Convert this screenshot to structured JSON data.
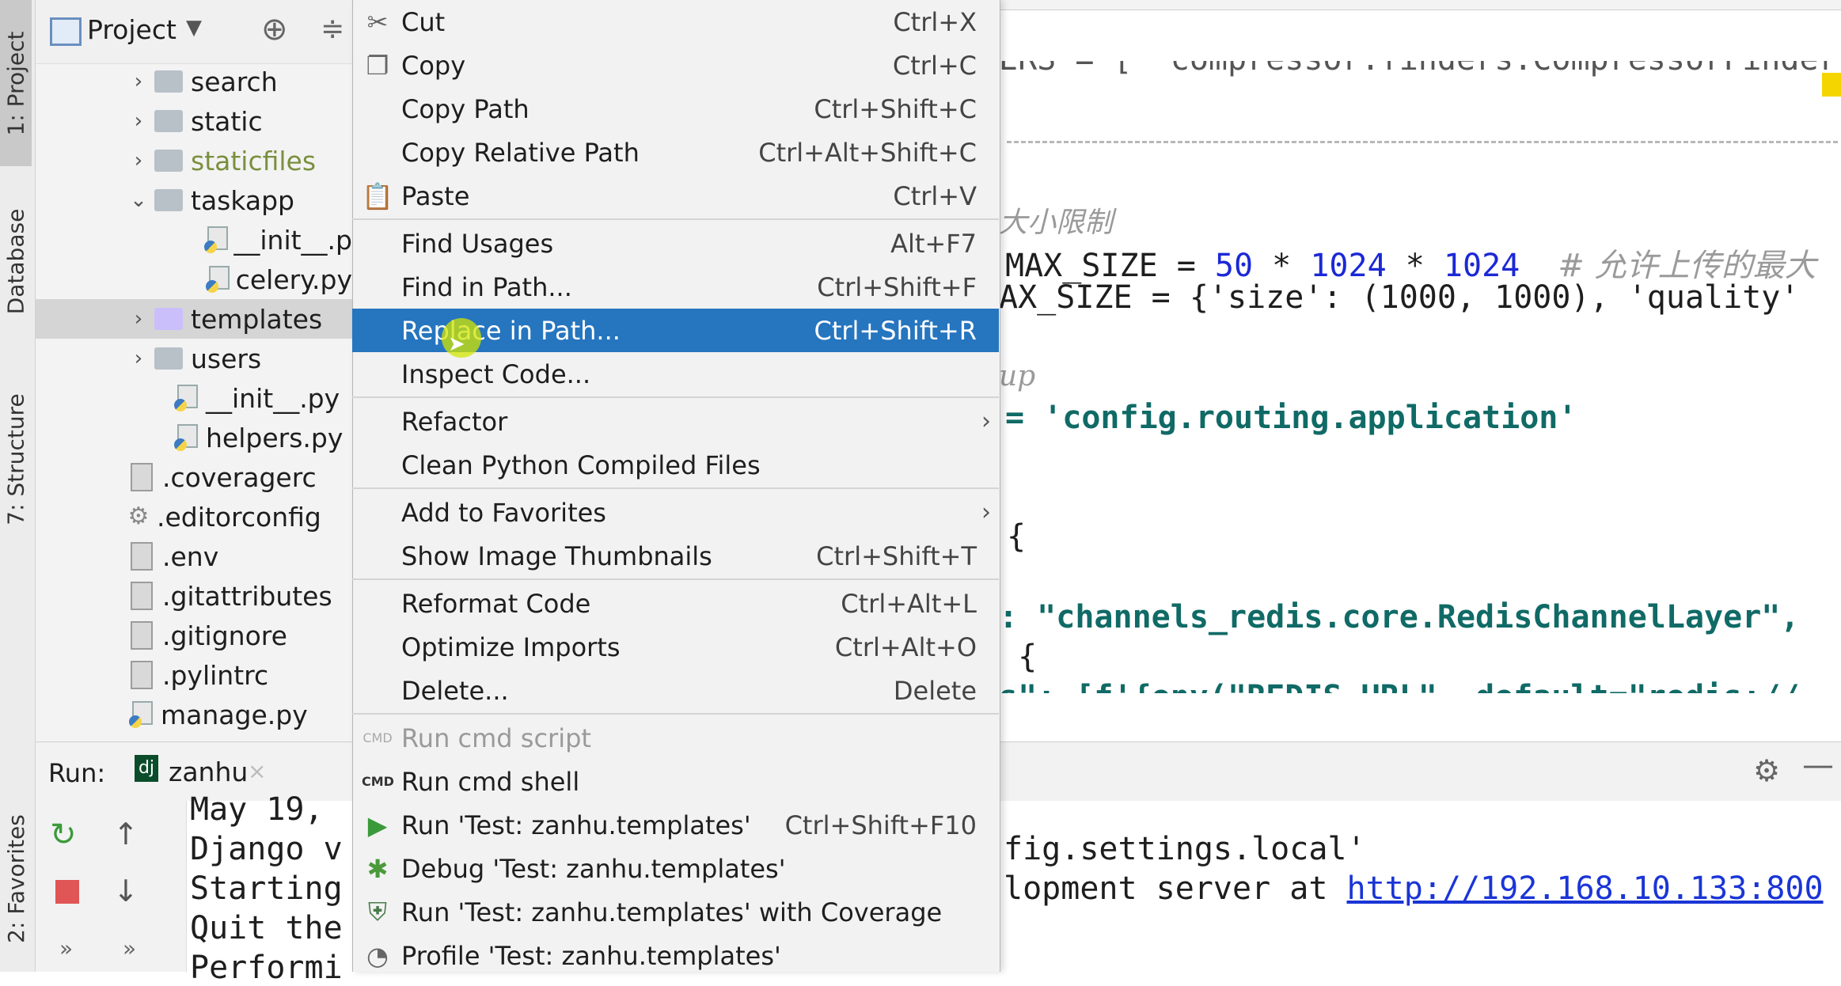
{
  "left_strip": {
    "tabs": [
      "1: Project",
      "Database",
      "7: Structure",
      "2: Favorites"
    ]
  },
  "project": {
    "title": "Project",
    "tree": [
      {
        "label": "search",
        "type": "folder",
        "expanded": false
      },
      {
        "label": "static",
        "type": "folder",
        "expanded": false
      },
      {
        "label": "staticfiles",
        "type": "folder",
        "expanded": false,
        "color": "#6b8a3a"
      },
      {
        "label": "taskapp",
        "type": "folder",
        "expanded": true
      },
      {
        "label": "__init__.p",
        "type": "python"
      },
      {
        "label": "celery.py",
        "type": "python"
      },
      {
        "label": "templates",
        "type": "folder",
        "expanded": false,
        "selected": true
      },
      {
        "label": "users",
        "type": "folder",
        "expanded": false
      },
      {
        "label": "__init__.py",
        "type": "python"
      },
      {
        "label": "helpers.py",
        "type": "python"
      },
      {
        "label": ".coveragerc",
        "type": "file"
      },
      {
        "label": ".editorconfig",
        "type": "config"
      },
      {
        "label": ".env",
        "type": "file"
      },
      {
        "label": ".gitattributes",
        "type": "file"
      },
      {
        "label": ".gitignore",
        "type": "file"
      },
      {
        "label": ".pylintrc",
        "type": "file"
      },
      {
        "label": "manage.py",
        "type": "python"
      }
    ]
  },
  "context_menu": {
    "items": [
      {
        "label": "Cut",
        "shortcut": "Ctrl+X",
        "icon": "scissors-icon"
      },
      {
        "label": "Copy",
        "shortcut": "Ctrl+C",
        "icon": "copy-icon"
      },
      {
        "label": "Copy Path",
        "shortcut": "Ctrl+Shift+C"
      },
      {
        "label": "Copy Relative Path",
        "shortcut": "Ctrl+Alt+Shift+C"
      },
      {
        "label": "Paste",
        "shortcut": "Ctrl+V",
        "icon": "paste-icon"
      },
      {
        "label": "Find Usages",
        "shortcut": "Alt+F7"
      },
      {
        "label": "Find in Path...",
        "shortcut": "Ctrl+Shift+F"
      },
      {
        "label": "Replace in Path...",
        "shortcut": "Ctrl+Shift+R",
        "highlighted": true
      },
      {
        "label": "Inspect Code..."
      },
      {
        "label": "Refactor",
        "submenu": true
      },
      {
        "label": "Clean Python Compiled Files"
      },
      {
        "label": "Add to Favorites",
        "submenu": true
      },
      {
        "label": "Show Image Thumbnails",
        "shortcut": "Ctrl+Shift+T"
      },
      {
        "label": "Reformat Code",
        "shortcut": "Ctrl+Alt+L"
      },
      {
        "label": "Optimize Imports",
        "shortcut": "Ctrl+Alt+O"
      },
      {
        "label": "Delete...",
        "shortcut": "Delete"
      },
      {
        "label": "Run cmd script",
        "disabled": true,
        "icon": "cmd-icon"
      },
      {
        "label": "Run cmd shell",
        "icon": "cmd-icon"
      },
      {
        "label": "Run 'Test: zanhu.templates'",
        "shortcut": "Ctrl+Shift+F10",
        "icon": "run-icon"
      },
      {
        "label": "Debug 'Test: zanhu.templates'",
        "icon": "bug-icon"
      },
      {
        "label": "Run 'Test: zanhu.templates' with Coverage",
        "icon": "coverage-icon"
      },
      {
        "label": "Profile 'Test: zanhu.templates'",
        "icon": "profile-icon"
      }
    ]
  },
  "editor": {
    "lines": {
      "top_partial": "ERS = [ 'compressor.finders.CompressorFinder',",
      "cn_comment1": "大小限制",
      "max_size_a": "MAX_SIZE = ",
      "max_size_a_vals": [
        "50",
        "1024",
        "1024"
      ],
      "max_size_a_comment": "# 允许上传的最大",
      "max_size_b": "AX_SIZE = {'size': (1000, 1000), 'quality'",
      "cn_comment2": "up",
      "routing": "= 'config.routing.application'",
      "brace1": "{",
      "channels": ": \"channels_redis.core.RedisChannelLayer\",",
      "brace2": " {",
      "bottom_partial": "s\": [f'{env(\"REDIS_URL\", default=\"redis://"
    }
  },
  "run_panel": {
    "label": "Run:",
    "tab": "zanhu",
    "console_left": [
      "May 19, ",
      "Django v",
      "Starting",
      "Quit the",
      "Performi"
    ],
    "console_right": [
      "fig.settings.local'",
      "lopment server at "
    ],
    "url": "http://192.168.10.133:800"
  }
}
